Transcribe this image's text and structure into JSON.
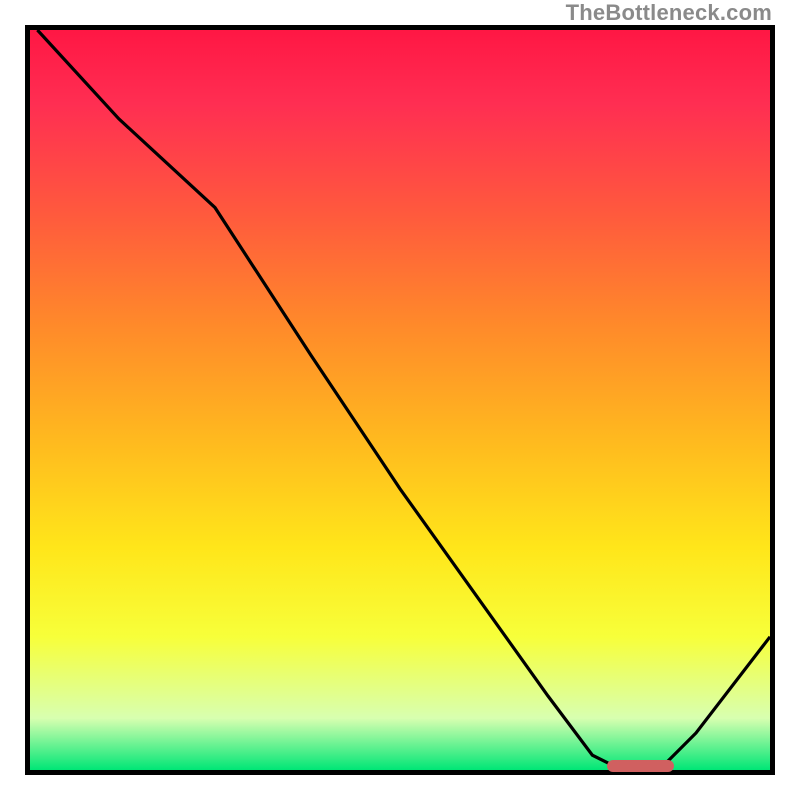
{
  "watermark": "TheBottleneck.com",
  "chart_data": {
    "type": "line",
    "title": "",
    "xlabel": "",
    "ylabel": "",
    "xlim": [
      0,
      100
    ],
    "ylim": [
      0,
      100
    ],
    "grid": false,
    "series": [
      {
        "name": "bottleneck-curve",
        "x": [
          1,
          12,
          25,
          38,
          50,
          60,
          70,
          76,
          80,
          85,
          90,
          100
        ],
        "values": [
          100,
          88,
          76,
          56,
          38,
          24,
          10,
          2,
          0,
          0,
          5,
          18
        ]
      }
    ],
    "marker": {
      "name": "highlight-range",
      "x_start": 78,
      "x_end": 87,
      "y": 0.5,
      "color": "#d06060"
    },
    "background_gradient": {
      "top": "#ff1744",
      "mid": "#ffe61a",
      "bottom": "#00e676"
    }
  }
}
